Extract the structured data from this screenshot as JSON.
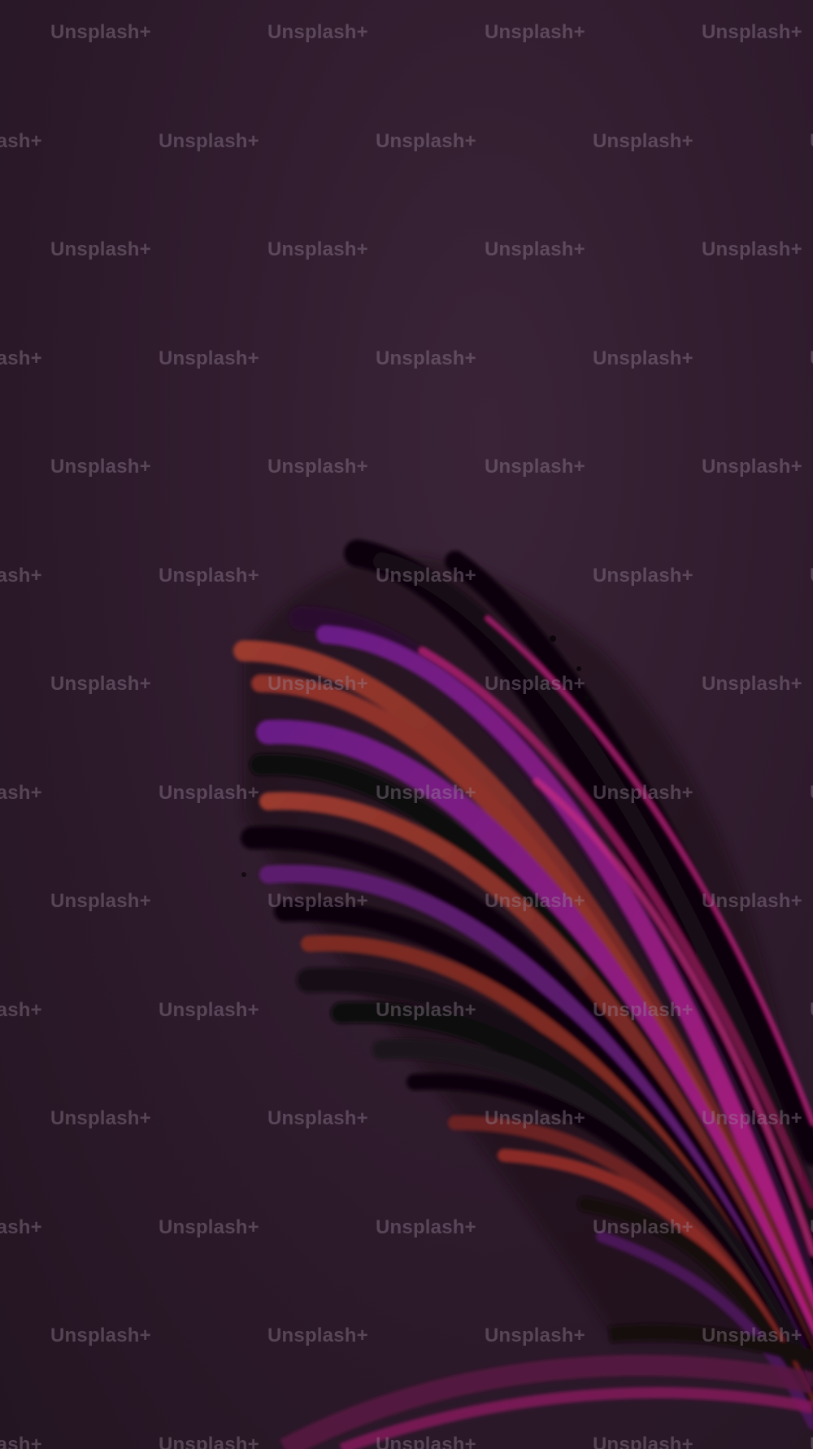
{
  "image": {
    "background_color": "#2d1a2b",
    "feather_colors": [
      "#0d070c",
      "#8a2f2a",
      "#7a1f86",
      "#b0207a",
      "#1a0f18"
    ]
  },
  "watermark": {
    "text": "Unsplash+"
  }
}
